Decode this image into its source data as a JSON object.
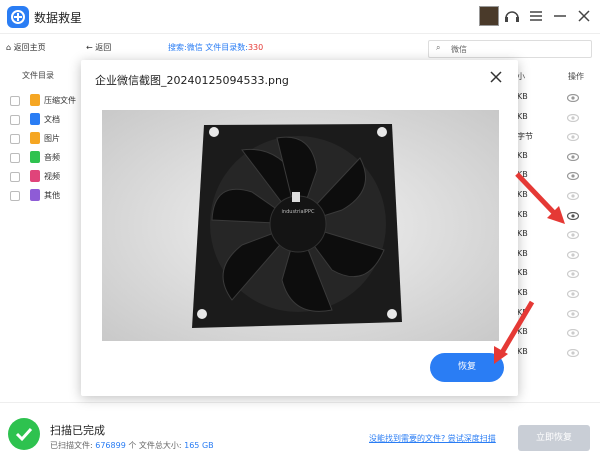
{
  "app": {
    "title": "数据救星"
  },
  "toolbar": {
    "home": "返回主页",
    "back": "返回",
    "search_prefix": "搜索:微信 文件目录数:",
    "search_count": "330",
    "search_placeholder": "微信"
  },
  "sidebar": {
    "header": "文件目录",
    "items": [
      {
        "label": "压缩文件",
        "color": "#f5a623"
      },
      {
        "label": "文档",
        "color": "#2a7df4"
      },
      {
        "label": "图片",
        "color": "#f5a623"
      },
      {
        "label": "音频",
        "color": "#2ec24f"
      },
      {
        "label": "视频",
        "color": "#e0447a"
      },
      {
        "label": "其他",
        "color": "#8e5cd6"
      }
    ]
  },
  "table": {
    "col_action": "操作",
    "col_size_partial": "小",
    "sizes": [
      "KB",
      "KB",
      "字节",
      "KB",
      "KB",
      "KB",
      "KB",
      "KB",
      "KB",
      "KB",
      "KB",
      "KB",
      "KB",
      "KB"
    ]
  },
  "dialog": {
    "title": "企业微信截图_20240125094533.png",
    "restore_label": "恢复"
  },
  "bottom": {
    "status": "扫描已完成",
    "stats_label1": "已扫描文件: ",
    "stats_files": "676899",
    "stats_label2": " 个 文件总大小: ",
    "stats_size": "165 GB",
    "deep_scan_link": "没能找到需要的文件? 尝试深度扫描",
    "recover_now": "立即恢复"
  },
  "colors": {
    "accent": "#2a7df4",
    "success": "#2ec24f",
    "arrow": "#e53935"
  }
}
